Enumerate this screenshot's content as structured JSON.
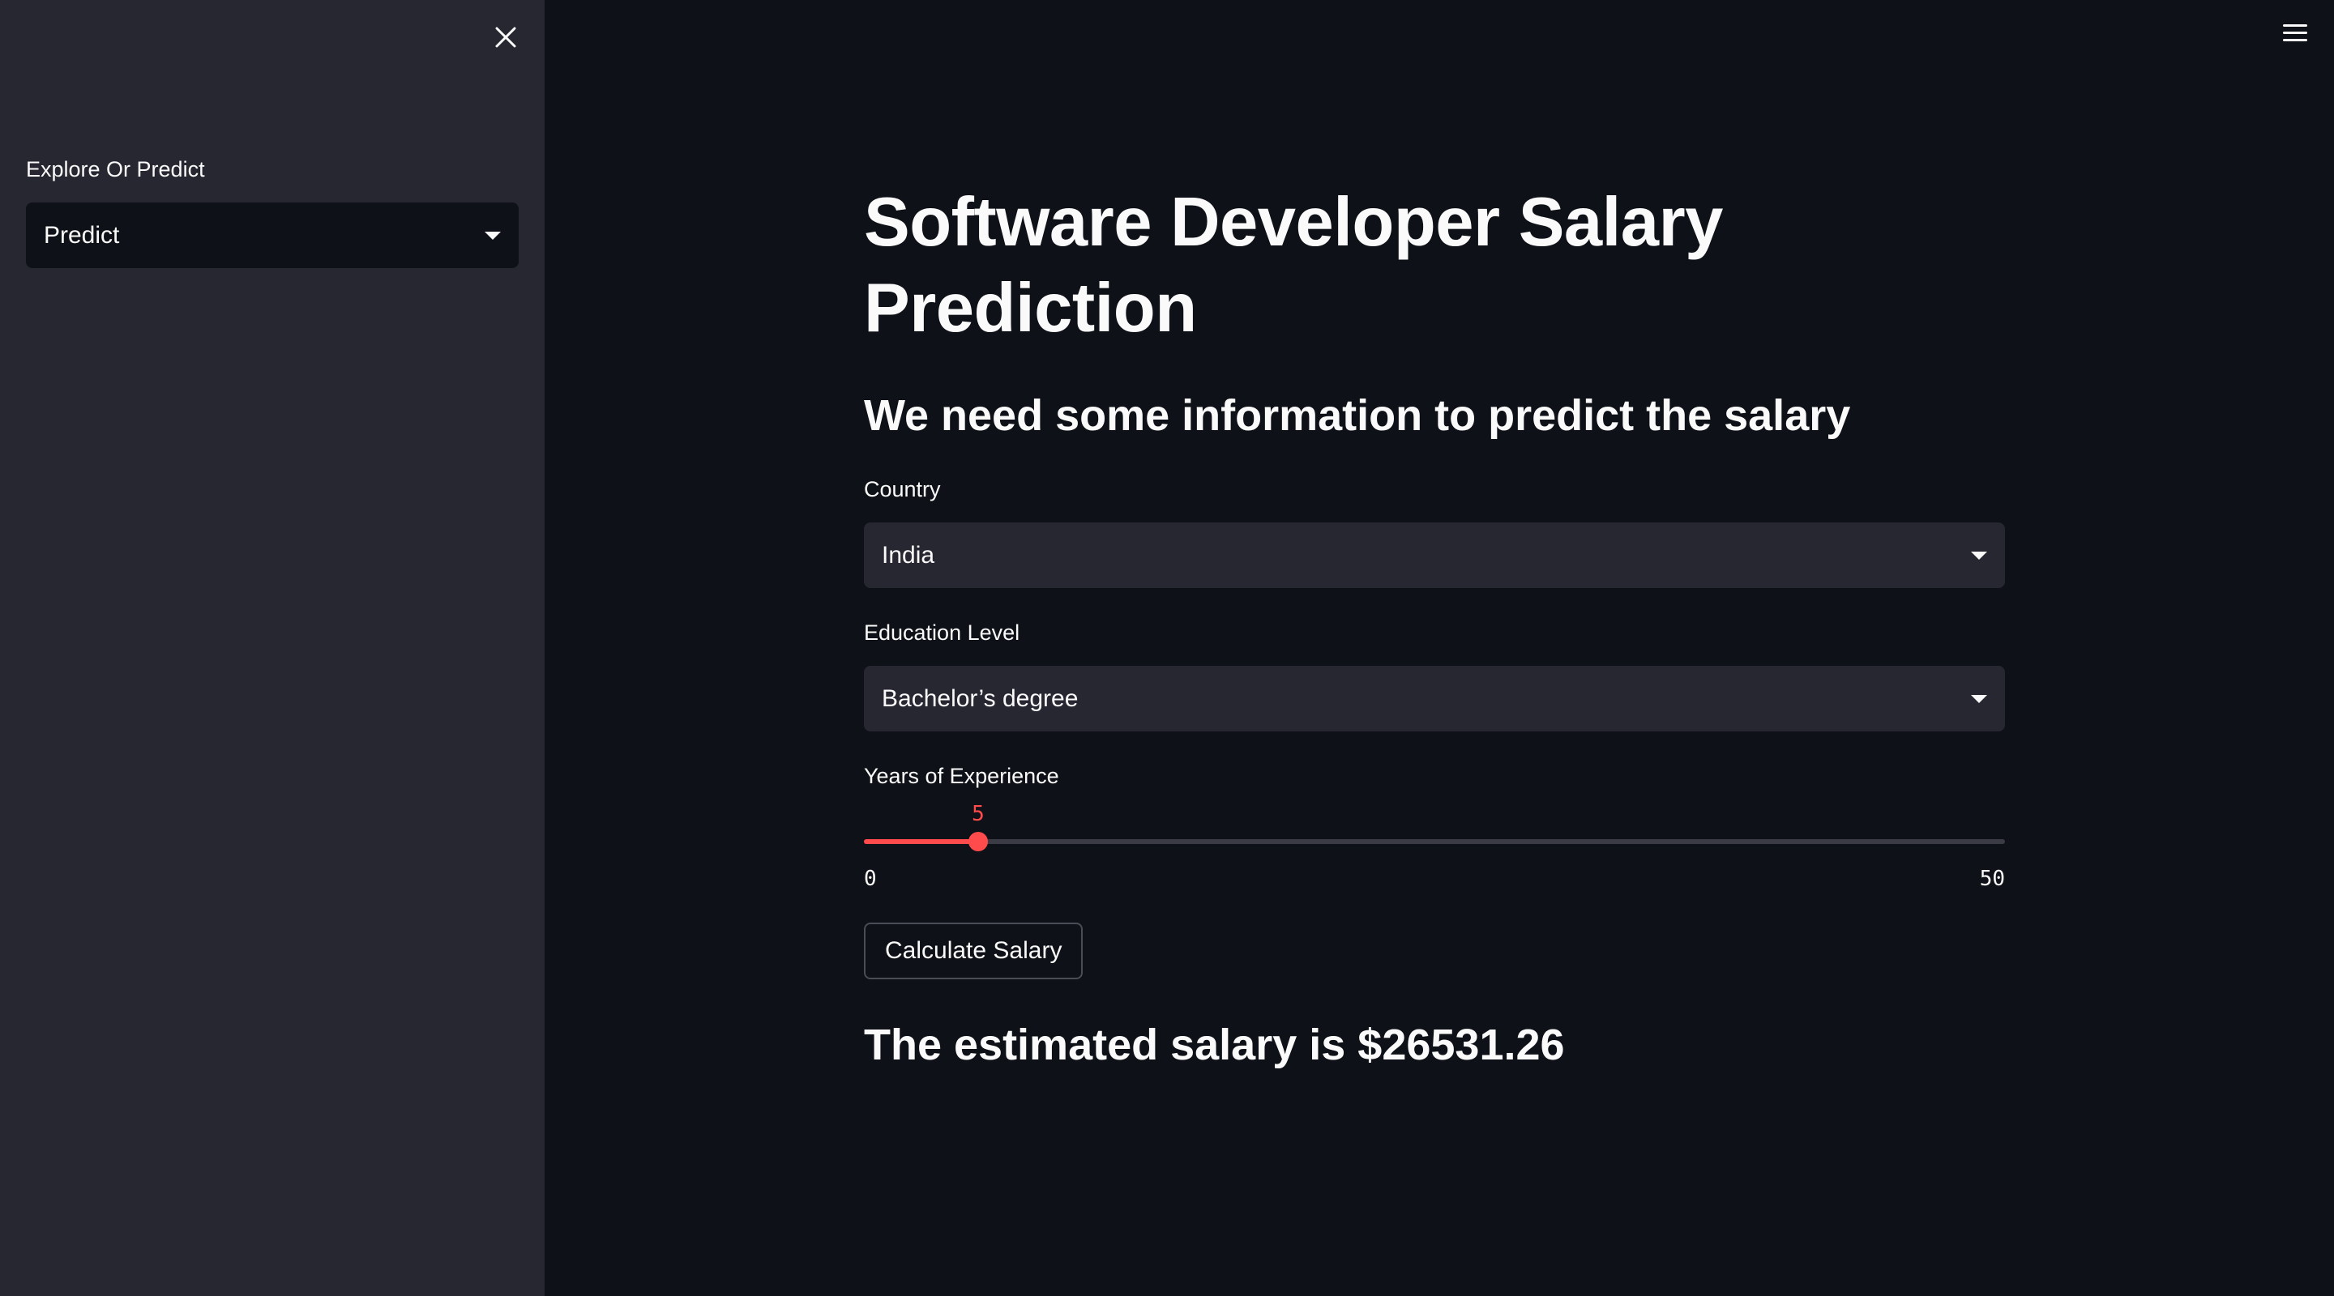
{
  "sidebar": {
    "label": "Explore Or Predict",
    "selected": "Predict"
  },
  "main": {
    "title": "Software Developer Salary Prediction",
    "subtitle": "We need some information to predict the salary",
    "country": {
      "label": "Country",
      "selected": "India"
    },
    "education": {
      "label": "Education Level",
      "selected": "Bachelor’s degree"
    },
    "experience": {
      "label": "Years of Experience",
      "value": 5,
      "min": 0,
      "max": 50,
      "value_text": "5",
      "min_text": "0",
      "max_text": "50"
    },
    "button_label": "Calculate Salary",
    "result": "The estimated salary is $26531.26"
  },
  "colors": {
    "background": "#0e1117",
    "sidebar": "#262730",
    "accent": "#ff4b4b",
    "text": "#fafafa"
  },
  "icons": {
    "close": "close-icon",
    "menu": "hamburger-menu-icon",
    "dropdown": "chevron-down-icon"
  }
}
